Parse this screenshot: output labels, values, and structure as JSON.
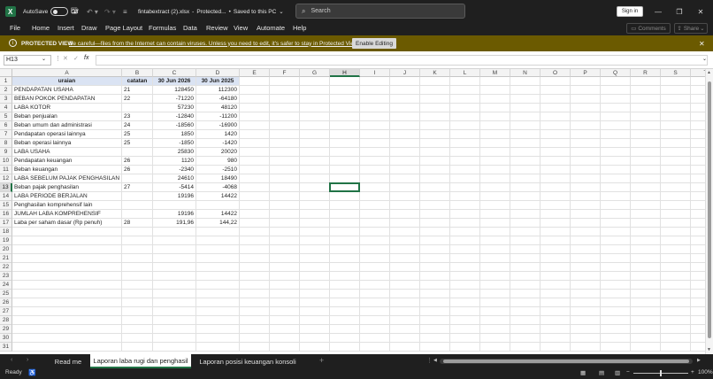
{
  "titlebar": {
    "autosave_label": "AutoSave",
    "autosave_state": "Off",
    "file_name": "fintabextract (2).xlsx",
    "file_status": "Protected...",
    "save_status": "Saved to this PC",
    "search_placeholder": "Search",
    "signin_label": "Sign in"
  },
  "menu": [
    "File",
    "Home",
    "Insert",
    "Draw",
    "Page Layout",
    "Formulas",
    "Data",
    "Review",
    "View",
    "Automate",
    "Help"
  ],
  "ribbon_buttons": {
    "comments": "Comments",
    "share": "Share"
  },
  "protected_view": {
    "label": "PROTECTED VIEW",
    "message": "Be careful—files from the Internet can contain viruses. Unless you need to edit, it's safer to stay in Protected View.",
    "button": "Enable Editing"
  },
  "formula_bar": {
    "name_box": "H13",
    "fx_label": "fx",
    "value": ""
  },
  "columns": [
    "A",
    "B",
    "C",
    "D",
    "E",
    "F",
    "G",
    "H",
    "I",
    "J",
    "K",
    "L",
    "M",
    "N",
    "O",
    "P",
    "Q",
    "R",
    "S",
    "T"
  ],
  "selected_column": "H",
  "selected_row": 13,
  "row_count": 31,
  "table": {
    "headers": [
      "uraian",
      "catatan",
      "30 Jun 2026",
      "30 Jun 2025"
    ],
    "rows": [
      [
        "PENDAPATAN USAHA",
        "21",
        "128450",
        "112300"
      ],
      [
        "BEBAN POKOK PENDAPATAN",
        "22",
        "-71220",
        "-64180"
      ],
      [
        "LABA KOTOR",
        "",
        "57230",
        "48120"
      ],
      [
        "Beban penjualan",
        "23",
        "-12840",
        "-11200"
      ],
      [
        "Beban umum dan administrasi",
        "24",
        "-18560",
        "-16900"
      ],
      [
        "Pendapatan operasi lainnya",
        "25",
        "1850",
        "1420"
      ],
      [
        "Beban operasi lainnya",
        "25",
        "-1850",
        "-1420"
      ],
      [
        "LABA USAHA",
        "",
        "25830",
        "20020"
      ],
      [
        "Pendapatan keuangan",
        "26",
        "1120",
        "980"
      ],
      [
        "Beban keuangan",
        "26",
        "-2340",
        "-2510"
      ],
      [
        "LABA SEBELUM PAJAK PENGHASILAN",
        "",
        "24610",
        "18490"
      ],
      [
        "Beban pajak penghasilan",
        "27",
        "-5414",
        "-4068"
      ],
      [
        "LABA PERIODE BERJALAN",
        "",
        "19196",
        "14422"
      ],
      [
        "Penghasilan komprehensif lain",
        "",
        "",
        ""
      ],
      [
        "JUMLAH LABA KOMPREHENSIF",
        "",
        "19196",
        "14422"
      ],
      [
        "Laba per saham dasar (Rp penuh)",
        "28",
        "191,96",
        "144,22"
      ]
    ]
  },
  "sheet_tabs": [
    "Read me",
    "Laporan laba rugi dan penghasil",
    "Laporan posisi keuangan konsoli"
  ],
  "active_tab": 1,
  "status": {
    "ready": "Ready",
    "zoom": "100%"
  }
}
